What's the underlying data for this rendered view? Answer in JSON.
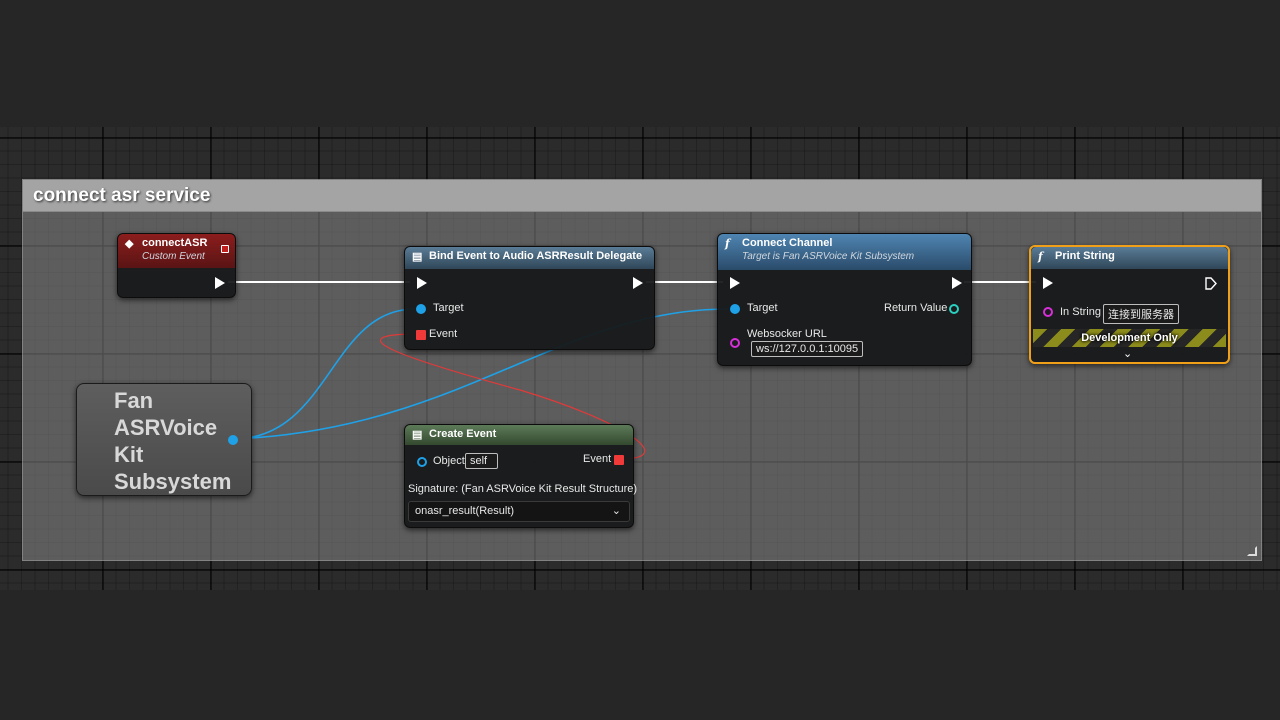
{
  "comment": {
    "title": "connect asr service"
  },
  "nodes": {
    "custom_event": {
      "title": "connectASR",
      "subtitle": "Custom Event"
    },
    "bind_event": {
      "title": "Bind Event to Audio ASRResult Delegate",
      "pin_target": "Target",
      "pin_event": "Event"
    },
    "connect_channel": {
      "title": "Connect Channel",
      "subtitle": "Target is Fan ASRVoice Kit Subsystem",
      "pin_target": "Target",
      "pin_return": "Return Value",
      "pin_url": "Websocker URL",
      "url_value": "ws://127.0.0.1:10095"
    },
    "print_string": {
      "title": "Print String",
      "pin_in_string": "In String",
      "in_string_value": "连接到服务器",
      "dev_only": "Development Only"
    },
    "create_event": {
      "title": "Create Event",
      "pin_object": "Object",
      "object_value": "self",
      "pin_event": "Event",
      "signature": "Signature: (Fan ASRVoice Kit Result Structure)",
      "selected_function": "onasr_result(Result)"
    },
    "subsystem": {
      "label": "Fan\nASRVoice\nKit\nSubsystem"
    }
  },
  "icons": {
    "custom_event": "event-diamond-icon",
    "function": "function-f-icon",
    "bind": "delegate-icon",
    "create": "delegate-icon"
  },
  "colors": {
    "exec_wire": "#ffffff",
    "object_wire": "#1fa1e8",
    "delegate_wire": "#e03a3a",
    "print_highlight": "#f0a018"
  }
}
